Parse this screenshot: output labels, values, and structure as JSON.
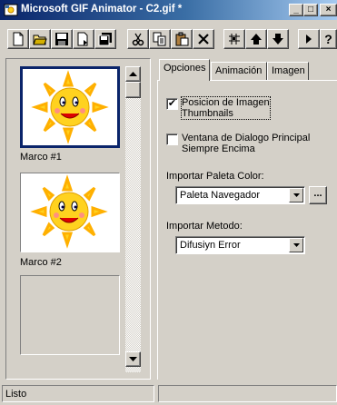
{
  "window": {
    "title": "Microsoft GIF Animator - C2.gif *",
    "minimize": "_",
    "maximize": "□",
    "close": "×"
  },
  "toolbar": {
    "buttons": [
      {
        "name": "new-button",
        "icon": "new-document-icon"
      },
      {
        "name": "open-button",
        "icon": "open-folder-icon"
      },
      {
        "name": "save-button",
        "icon": "save-disk-icon"
      },
      {
        "name": "insert-button",
        "icon": "insert-file-icon"
      },
      {
        "name": "save-as-button",
        "icon": "save-as-icon"
      },
      {
        "name": "cut-button",
        "icon": "scissors-icon"
      },
      {
        "name": "copy-button",
        "icon": "copy-icon"
      },
      {
        "name": "paste-button",
        "icon": "paste-icon"
      },
      {
        "name": "delete-button",
        "icon": "delete-x-icon"
      },
      {
        "name": "select-all-button",
        "icon": "select-all-icon"
      },
      {
        "name": "move-up-button",
        "icon": "arrow-up-icon"
      },
      {
        "name": "move-down-button",
        "icon": "arrow-down-icon"
      },
      {
        "name": "play-button",
        "icon": "play-icon"
      },
      {
        "name": "help-button",
        "icon": "help-icon",
        "label": "?"
      }
    ]
  },
  "frames": [
    {
      "label": "Marco #1",
      "selected": true
    },
    {
      "label": "Marco #2",
      "selected": false
    },
    {
      "label": "",
      "selected": false
    }
  ],
  "tabs": [
    {
      "label": "Opciones",
      "active": true
    },
    {
      "label": "Animación",
      "active": false
    },
    {
      "label": "Imagen",
      "active": false
    }
  ],
  "options": {
    "thumbnails": {
      "label_line1": "Posicion de Imagen",
      "label_line2": "Thumbnails",
      "checked": true,
      "mark": "✔"
    },
    "on_top": {
      "label_line1": "Ventana de Dialogo Principal",
      "label_line2": "Siempre Encima",
      "checked": false
    },
    "palette": {
      "label": "Importar Paleta Color:",
      "value": "Paleta Navegador",
      "browse": "..."
    },
    "method": {
      "label": "Importar Metodo:",
      "value": "Difusiyn Error"
    }
  },
  "status": {
    "text": "Listo"
  },
  "colors": {
    "titlebar": "#0a246a",
    "face": "#d4d0c8",
    "selection": "#0a246a",
    "sun": "#ffd21f"
  }
}
